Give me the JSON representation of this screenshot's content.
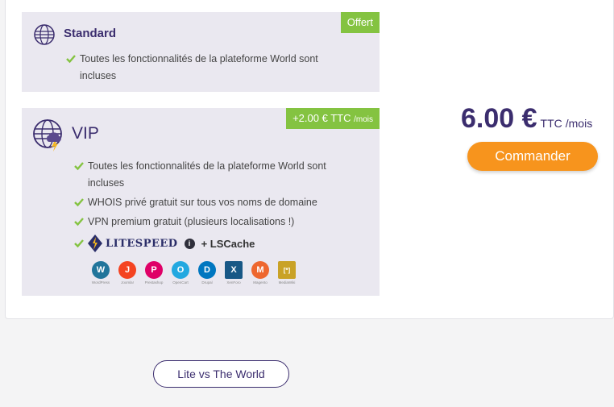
{
  "standard": {
    "name": "Standard",
    "badge": "Offert",
    "features": [
      "Toutes les fonctionnalités de la plateforme World sont incluses"
    ]
  },
  "vip": {
    "name": "VIP",
    "badge_price": "+2.00 € TTC",
    "badge_period": "/mois",
    "features": [
      "Toutes les fonctionnalités de la plateforme World sont incluses",
      "WHOIS privé gratuit sur tous vos noms de domaine",
      "VPN premium gratuit (plusieurs localisations !)"
    ],
    "litespeed_label": "LITESPEED",
    "info_icon": "i",
    "lscache_label": "+ LSCache",
    "apps": [
      {
        "name": "WordPress",
        "glyph": "W",
        "color": "#21759b"
      },
      {
        "name": "Joomla!",
        "glyph": "J",
        "color": "#f44321"
      },
      {
        "name": "Prestashop",
        "glyph": "P",
        "color": "#df0067"
      },
      {
        "name": "OpenCart",
        "glyph": "O",
        "color": "#23a8e0"
      },
      {
        "name": "Drupal",
        "glyph": "D",
        "color": "#0077c0"
      },
      {
        "name": "XenForo",
        "glyph": "X",
        "color": "#185886"
      },
      {
        "name": "Magento",
        "glyph": "M",
        "color": "#ee672f"
      },
      {
        "name": "MediaWiki",
        "glyph": "[*]",
        "color": "#c9a227"
      }
    ]
  },
  "pricing": {
    "amount": "6.00 €",
    "tax": "TTC",
    "period": "/mois",
    "order_label": "Commander"
  },
  "compare": {
    "label": "Lite vs The World"
  },
  "colors": {
    "accent": "#3b2d6e",
    "badge": "#84c341",
    "order": "#f7941d",
    "check": "#84c341"
  }
}
